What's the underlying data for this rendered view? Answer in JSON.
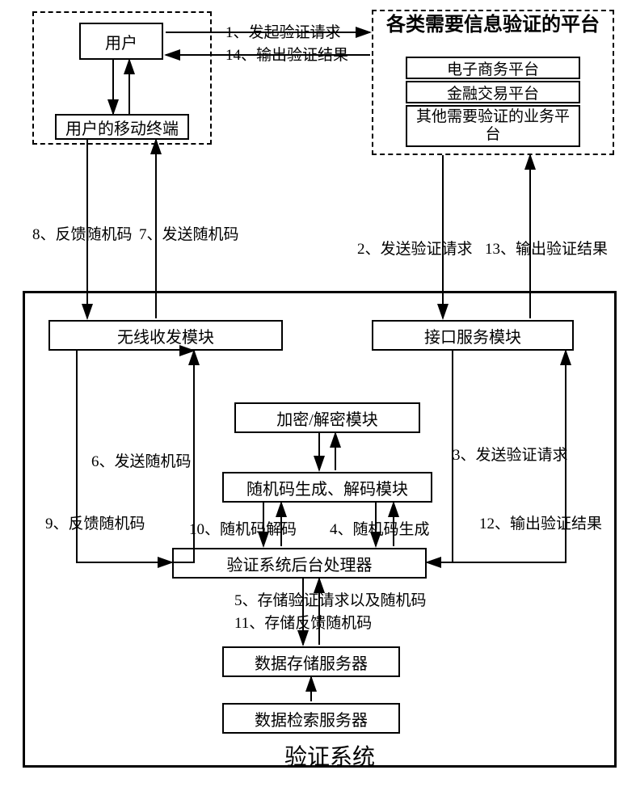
{
  "chart_data": {
    "type": "flow-diagram",
    "nodes": {
      "user": "用户",
      "mobile": "用户的移动终端",
      "platform_group": "各类需要信息验证的平台",
      "platform1": "电子商务平台",
      "platform2": "金融交易平台",
      "platform3": "其他需要验证的业务平台",
      "wireless": "无线收发模块",
      "interface": "接口服务模块",
      "crypt": "加密/解密模块",
      "randgen": "随机码生成、解码模块",
      "backend": "验证系统后台处理器",
      "storage": "数据存储服务器",
      "retrieval": "数据检索服务器"
    },
    "system_label": "验证系统",
    "edge_labels": {
      "e1": "1、发起验证请求",
      "e14": "14、输出验证结果",
      "e8": "8、反馈随机码",
      "e7": "7、发送随机码",
      "e2": "2、发送验证请求",
      "e13": "13、输出验证结果",
      "e6": "6、发送随机码",
      "e9": "9、反馈随机码",
      "e3": "3、发送验证请求",
      "e12": "12、输出验证结果",
      "e10": "10、随机码解码",
      "e4": "4、随机码生成",
      "e5": "5、存储验证请求以及随机码",
      "e11": "11、存储反馈随机码"
    }
  }
}
